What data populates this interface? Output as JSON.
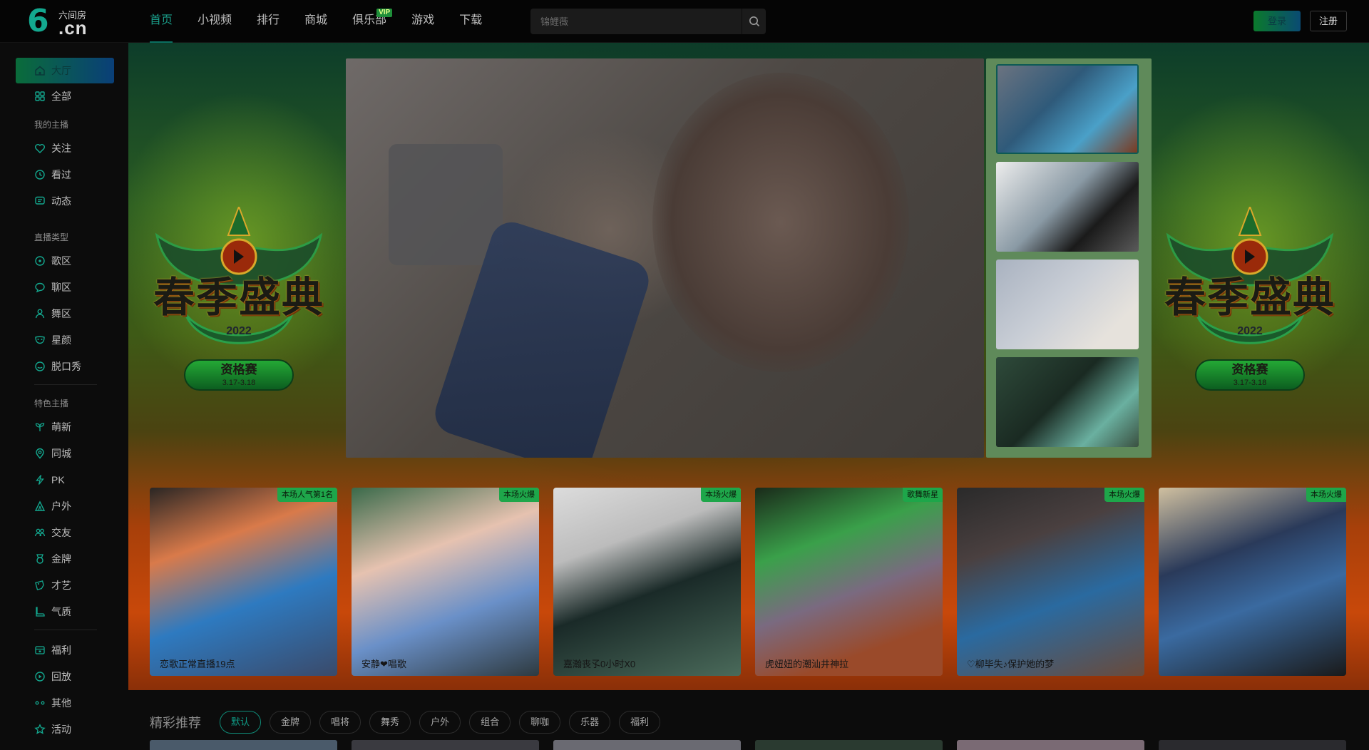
{
  "brand": {
    "glyph": "6",
    "top_text": "六间房",
    "domain_text": ".cn"
  },
  "nav": {
    "items": [
      {
        "label": "首页"
      },
      {
        "label": "小视频"
      },
      {
        "label": "排行"
      },
      {
        "label": "商城"
      },
      {
        "label": "俱乐部",
        "badge": "VIP"
      },
      {
        "label": "游戏"
      },
      {
        "label": "下载"
      }
    ],
    "active_index": 0
  },
  "search": {
    "placeholder": "锦鲤薇"
  },
  "auth": {
    "login_label": "登录",
    "register_label": "注册"
  },
  "sidebar": {
    "home": "大厅",
    "all": "全部",
    "group_my": "我的主播",
    "my_items": [
      "关注",
      "看过",
      "动态"
    ],
    "group_types": "直播类型",
    "type_items": [
      "歌区",
      "聊区",
      "舞区",
      "星颜",
      "脱口秀"
    ],
    "group_feature": "特色主播",
    "feature_items": [
      "萌新",
      "同城",
      "PK",
      "户外",
      "交友",
      "金牌",
      "才艺",
      "气质"
    ],
    "bottom_items": [
      "福利",
      "回放",
      "其他",
      "活动"
    ]
  },
  "hero": {
    "event_title": "春季盛典",
    "event_year": "2022",
    "event_badge": "资格赛",
    "event_dates": "3.17-3.18"
  },
  "cards": [
    {
      "tag": "本场人气第1名",
      "caption": "恋歌正常直播19点"
    },
    {
      "tag": "本场火爆",
      "caption": "安静❤唱歌"
    },
    {
      "tag": "本场火爆",
      "caption": "嘉瀚丧孓0小时X0"
    },
    {
      "tag": "歌舞新星",
      "caption": "虎妞妞的潮汕井神拉"
    },
    {
      "tag": "本场火爆",
      "caption": "♡柳毕失♪保护她的梦"
    },
    {
      "tag": "本场火爆",
      "caption": ""
    }
  ],
  "recommend": {
    "title": "精彩推荐",
    "chips": [
      "默认",
      "金牌",
      "唱将",
      "舞秀",
      "户外",
      "组合",
      "聊咖",
      "乐器",
      "福利"
    ],
    "active_index": 0
  },
  "colors": {
    "accent": "#0f9a85",
    "brand_green": "#13a88f",
    "tag_green": "#1ea64a",
    "topbar": "#050505"
  }
}
